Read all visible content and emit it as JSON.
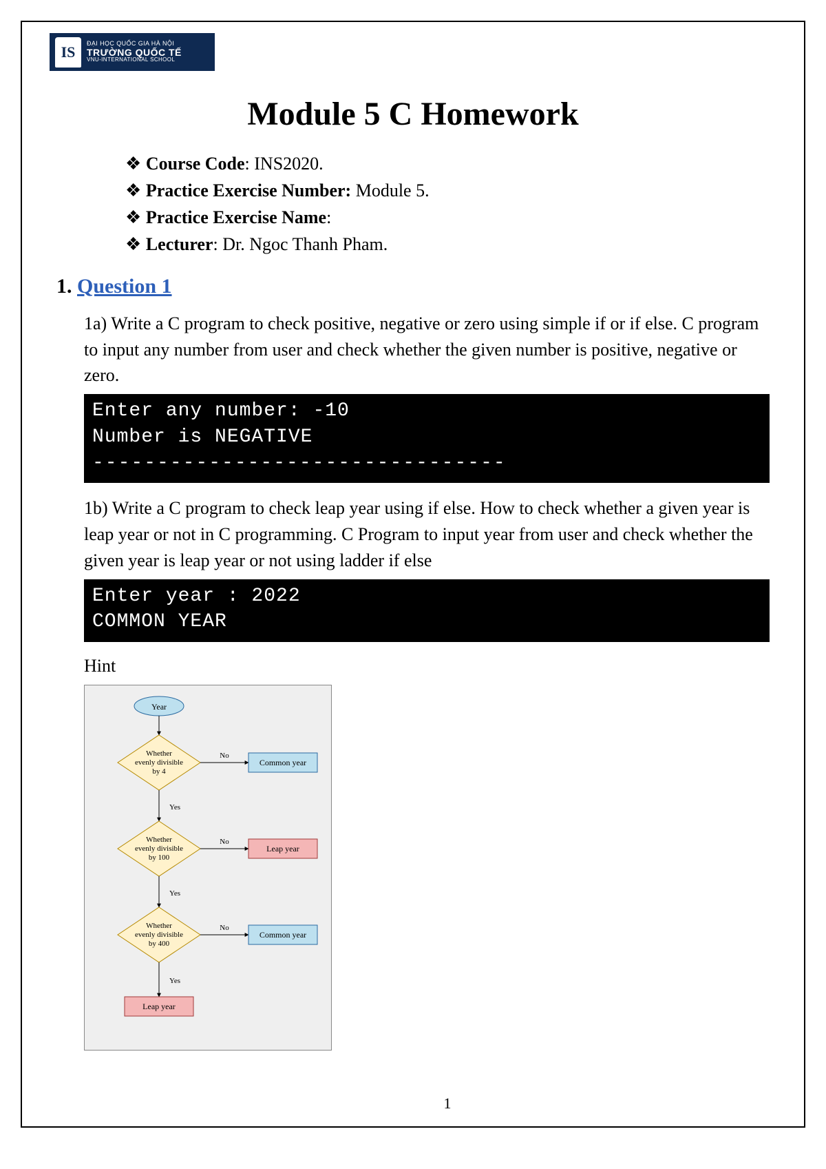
{
  "logo": {
    "mark": "IS",
    "line1": "ĐẠI HỌC QUỐC GIA HÀ NỘI",
    "line2": "TRƯỜNG QUỐC TẾ",
    "line3": "VNU-INTERNATIONAL SCHOOL"
  },
  "title": "Module 5 C Homework",
  "info": {
    "course_label": "Course Code",
    "course_value": ": INS2020.",
    "exnum_label": "Practice Exercise Number:",
    "exnum_value": " Module 5.",
    "exname_label": "Practice Exercise Name",
    "exname_value": ":",
    "lecturer_label": "Lecturer",
    "lecturer_value": ": Dr. Ngoc Thanh Pham."
  },
  "section": {
    "num": "1. ",
    "title": "Question 1"
  },
  "q1a": "1a) Write a C program to check positive, negative or zero using simple if or if else. C program to input any number from user and check whether the given number is positive, negative or zero.",
  "term1": {
    "l1": "Enter any number: -10",
    "l2": "Number is NEGATIVE",
    "l3": "--------------------------------"
  },
  "q1b": "1b) Write a C program to check leap year using if else. How to check whether a given year is leap year or not in C programming. C Program to input year from user and check whether the given year is leap year or not using ladder if else",
  "term2": {
    "l1": "Enter year : 2022",
    "l2": "COMMON YEAR"
  },
  "hint": "Hint",
  "page_number": "1",
  "chart_data": {
    "type": "flowchart",
    "title": "Leap year decision flow",
    "nodes": [
      {
        "id": "start",
        "kind": "terminator",
        "label": "Year"
      },
      {
        "id": "d4",
        "kind": "decision",
        "label": "Whether evenly divisible by 4"
      },
      {
        "id": "c1",
        "kind": "process",
        "label": "Common year",
        "color": "#bde0ef"
      },
      {
        "id": "d100",
        "kind": "decision",
        "label": "Whether evenly divisible by 100"
      },
      {
        "id": "l1",
        "kind": "process",
        "label": "Leap year",
        "color": "#f4b6b6"
      },
      {
        "id": "d400",
        "kind": "decision",
        "label": "Whether evenly divisible by 400"
      },
      {
        "id": "c2",
        "kind": "process",
        "label": "Common year",
        "color": "#bde0ef"
      },
      {
        "id": "l2",
        "kind": "process",
        "label": "Leap year",
        "color": "#f4b6b6"
      }
    ],
    "edges": [
      {
        "from": "start",
        "to": "d4",
        "label": ""
      },
      {
        "from": "d4",
        "to": "c1",
        "label": "No"
      },
      {
        "from": "d4",
        "to": "d100",
        "label": "Yes"
      },
      {
        "from": "d100",
        "to": "l1",
        "label": "No"
      },
      {
        "from": "d100",
        "to": "d400",
        "label": "Yes"
      },
      {
        "from": "d400",
        "to": "c2",
        "label": "No"
      },
      {
        "from": "d400",
        "to": "l2",
        "label": "Yes"
      }
    ],
    "edge_labels": {
      "yes": "Yes",
      "no": "No"
    },
    "node_labels": {
      "start": "Year",
      "d4_l1": "Whether",
      "d4_l2": "evenly divisible",
      "d4_l3": "by 4",
      "d100_l1": "Whether",
      "d100_l2": "evenly divisible",
      "d100_l3": "by 100",
      "d400_l1": "Whether",
      "d400_l2": "evenly divisible",
      "d400_l3": "by 400",
      "common": "Common year",
      "leap": "Leap year"
    }
  }
}
